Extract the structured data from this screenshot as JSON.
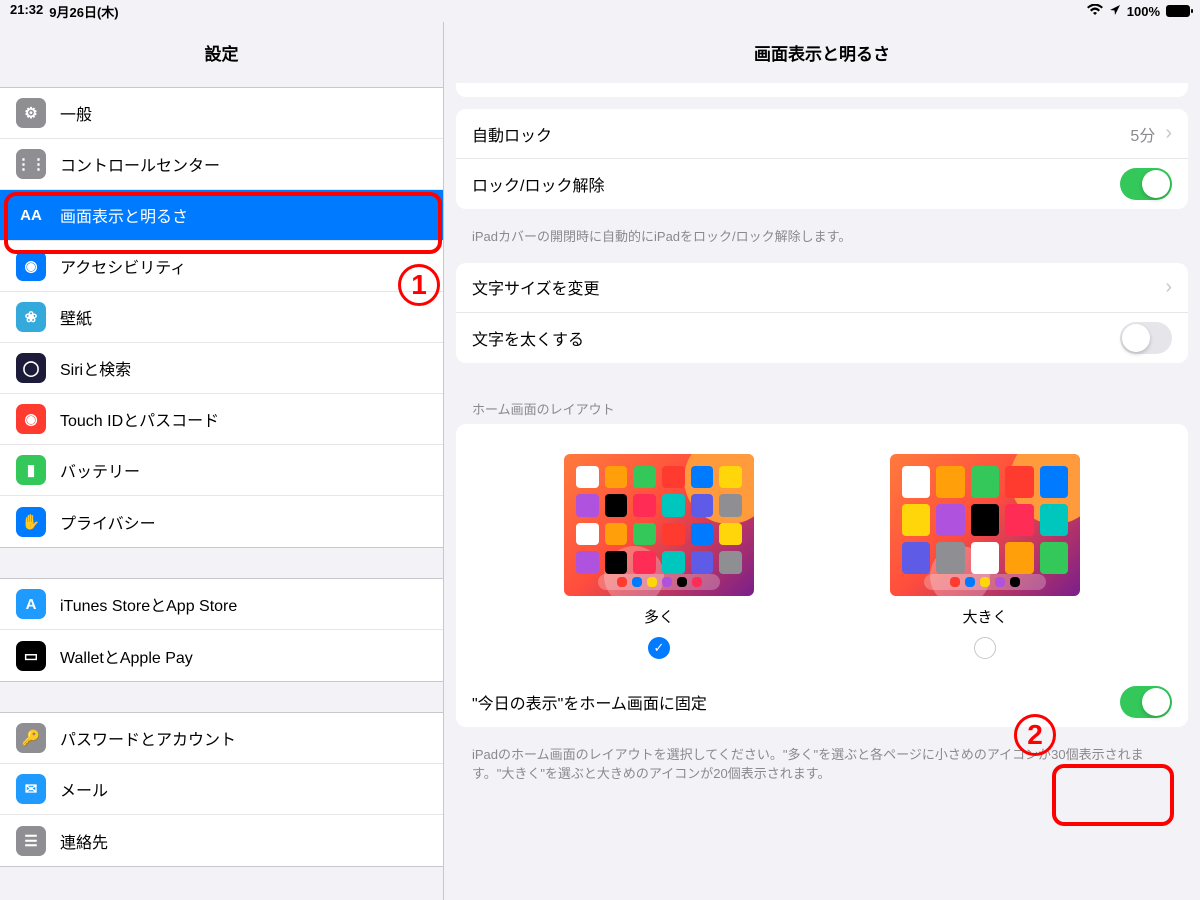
{
  "status": {
    "time": "21:32",
    "date": "9月26日(木)",
    "battery_pct": "100%"
  },
  "sidebar": {
    "title": "設定",
    "groups": [
      {
        "items": [
          {
            "id": "general",
            "label": "一般",
            "icon_bg": "#8e8e93",
            "icon_glyph": "⚙"
          },
          {
            "id": "control-center",
            "label": "コントロールセンター",
            "icon_bg": "#8e8e93",
            "icon_glyph": "⋮⋮"
          },
          {
            "id": "display",
            "label": "画面表示と明るさ",
            "icon_bg": "#007aff",
            "icon_glyph": "AA",
            "selected": true
          },
          {
            "id": "accessibility",
            "label": "アクセシビリティ",
            "icon_bg": "#007aff",
            "icon_glyph": "◉"
          },
          {
            "id": "wallpaper",
            "label": "壁紙",
            "icon_bg": "#34aadc",
            "icon_glyph": "❀"
          },
          {
            "id": "siri",
            "label": "Siriと検索",
            "icon_bg": "#1c1c3a",
            "icon_glyph": "◯"
          },
          {
            "id": "touchid",
            "label": "Touch IDとパスコード",
            "icon_bg": "#ff3b30",
            "icon_glyph": "◉"
          },
          {
            "id": "battery",
            "label": "バッテリー",
            "icon_bg": "#34c759",
            "icon_glyph": "▮"
          },
          {
            "id": "privacy",
            "label": "プライバシー",
            "icon_bg": "#007aff",
            "icon_glyph": "✋"
          }
        ]
      },
      {
        "items": [
          {
            "id": "itunes",
            "label": "iTunes StoreとApp Store",
            "icon_bg": "#1f9bff",
            "icon_glyph": "A"
          },
          {
            "id": "wallet",
            "label": "WalletとApple Pay",
            "icon_bg": "#000",
            "icon_glyph": "▭"
          }
        ]
      },
      {
        "items": [
          {
            "id": "passwords",
            "label": "パスワードとアカウント",
            "icon_bg": "#8e8e93",
            "icon_glyph": "🔑"
          },
          {
            "id": "mail",
            "label": "メール",
            "icon_bg": "#1f9bff",
            "icon_glyph": "✉"
          },
          {
            "id": "contacts",
            "label": "連絡先",
            "icon_bg": "#8e8e93",
            "icon_glyph": "☰"
          }
        ]
      }
    ]
  },
  "main": {
    "title": "画面表示と明るさ",
    "auto_lock": {
      "label": "自動ロック",
      "value": "5分"
    },
    "lock_unlock": {
      "label": "ロック/ロック解除",
      "on": true,
      "hint": "iPadカバーの開閉時に自動的にiPadをロック/ロック解除します。"
    },
    "text_size": {
      "label": "文字サイズを変更"
    },
    "bold_text": {
      "label": "文字を太くする",
      "on": false
    },
    "home_layout": {
      "header": "ホーム画面のレイアウト",
      "options": [
        {
          "id": "more",
          "label": "多く",
          "checked": true
        },
        {
          "id": "bigger",
          "label": "大きく",
          "checked": false
        }
      ],
      "today_pin": {
        "label": "\"今日の表示\"をホーム画面に固定",
        "on": true
      },
      "hint": "iPadのホーム画面のレイアウトを選択してください。\"多く\"を選ぶと各ページに小さめのアイコンが30個表示されます。\"大きく\"を選ぶと大きめのアイコンが20個表示されます。"
    }
  },
  "annotations": {
    "n1": "1",
    "n2": "2"
  },
  "palette": {
    "mini": [
      "#fff",
      "#ff9f0a",
      "#34c759",
      "#ff3b30",
      "#007aff",
      "#ffd60a",
      "#af52de",
      "#000",
      "#ff2d55",
      "#00c7be",
      "#5e5ce6",
      "#8e8e93"
    ]
  }
}
